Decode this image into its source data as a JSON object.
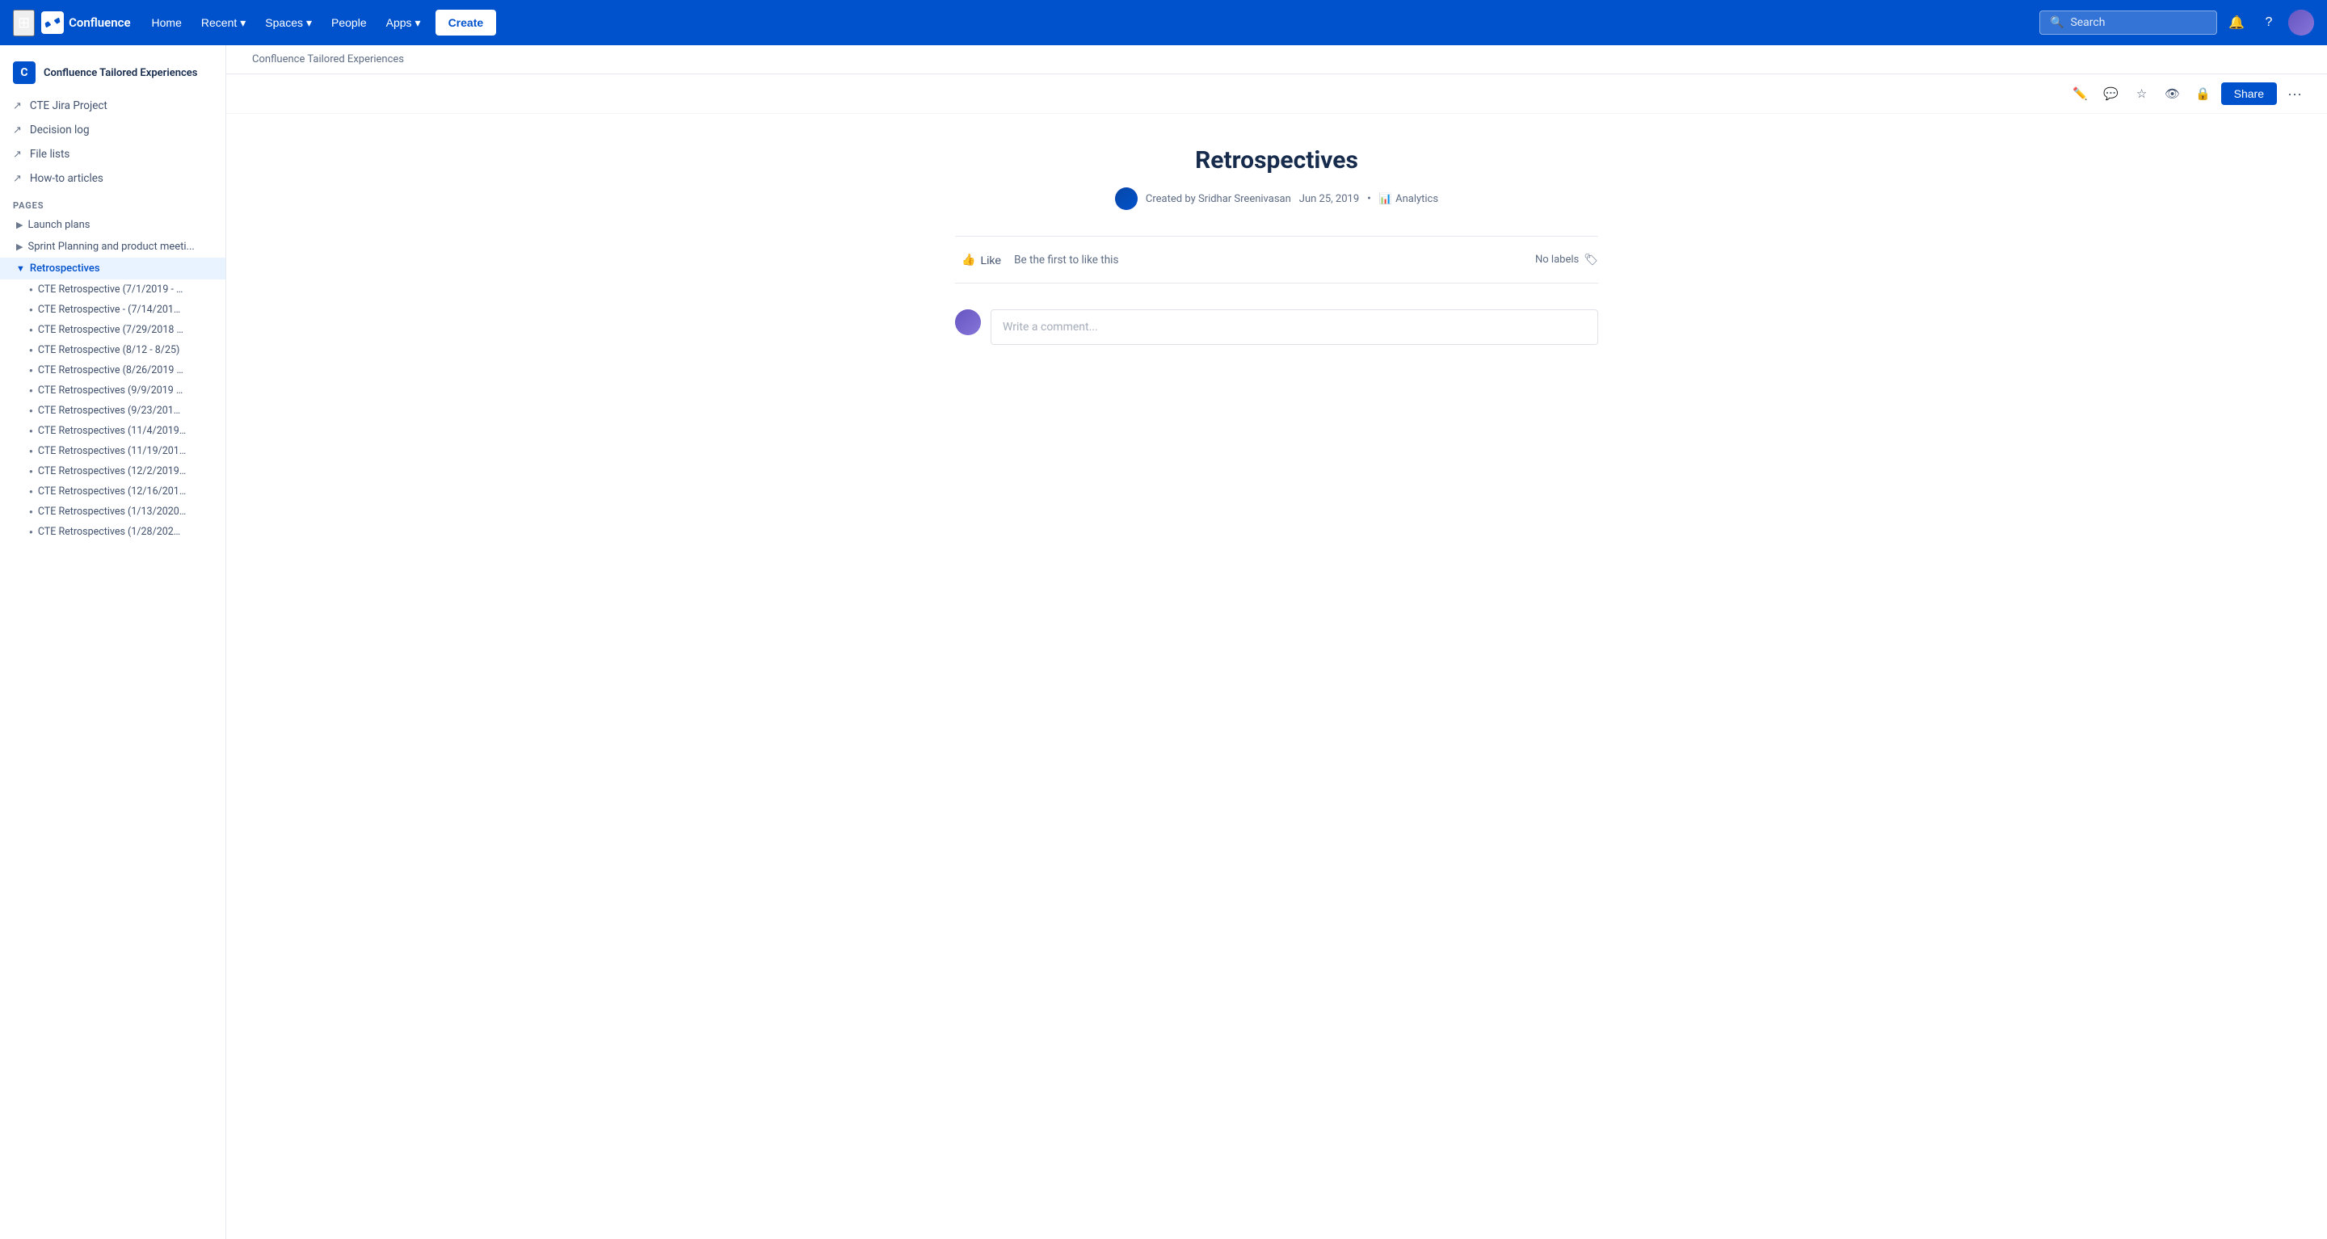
{
  "nav": {
    "logo_text": "Confluence",
    "home": "Home",
    "recent": "Recent",
    "spaces": "Spaces",
    "people": "People",
    "apps": "Apps",
    "create": "Create",
    "search_placeholder": "Search"
  },
  "sidebar": {
    "space_name": "Confluence Tailored Experiences",
    "space_initials": "C",
    "nav_items": [
      {
        "label": "CTE Jira Project",
        "icon": "↗"
      },
      {
        "label": "Decision log",
        "icon": "↗"
      },
      {
        "label": "File lists",
        "icon": "↗"
      },
      {
        "label": "How-to articles",
        "icon": "↗"
      }
    ],
    "pages_label": "PAGES",
    "pages": [
      {
        "label": "Launch plans",
        "expanded": false
      },
      {
        "label": "Sprint Planning and product meeti...",
        "expanded": false
      },
      {
        "label": "Retrospectives",
        "active": true,
        "expanded": true
      }
    ],
    "child_pages": [
      "CTE Retrospective (7/1/2019 - …",
      "CTE Retrospective - (7/14/201…",
      "CTE Retrospective (7/29/2018 …",
      "CTE Retrospective (8/12 - 8/25)",
      "CTE Retrospective (8/26/2019 …",
      "CTE Retrospectives (9/9/2019 …",
      "CTE Retrospectives (9/23/201…",
      "CTE Retrospectives (11/4/2019…",
      "CTE Retrospectives (11/19/201…",
      "CTE Retrospectives (12/2/2019…",
      "CTE Retrospectives (12/16/201…",
      "CTE Retrospectives (1/13/2020…",
      "CTE Retrospectives (1/28/202…"
    ]
  },
  "breadcrumb": "Confluence Tailored Experiences",
  "toolbar": {
    "share_label": "Share",
    "edit_icon": "✏",
    "comment_icon": "💬",
    "star_icon": "☆",
    "watch_icon": "👁",
    "restrict_icon": "🔒",
    "more_icon": "···"
  },
  "page": {
    "title": "Retrospectives",
    "created_by": "Created by Sridhar Sreenivasan",
    "date": "Jun 25, 2019",
    "analytics": "Analytics",
    "like_label": "Like",
    "like_subtext": "Be the first to like this",
    "no_labels": "No labels",
    "comment_placeholder": "Write a comment..."
  }
}
